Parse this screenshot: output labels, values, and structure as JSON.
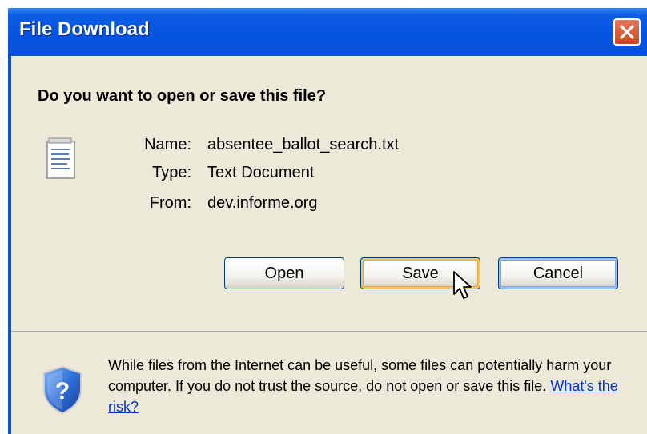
{
  "window": {
    "title": "File Download",
    "close_icon": "close-icon",
    "titlebar_color": "#0554e0",
    "body_color": "#ece9d8"
  },
  "dialog": {
    "question": "Do you want to open or save this file?",
    "file_icon": "text-document-icon",
    "fields": [
      {
        "label": "Name:",
        "value": "absentee_ballot_search.txt"
      },
      {
        "label": "Type:",
        "value": "Text Document"
      },
      {
        "label": "From:",
        "value": "dev.informe.org"
      }
    ],
    "buttons": {
      "open": "Open",
      "save": "Save",
      "cancel": "Cancel"
    }
  },
  "warning": {
    "icon": "security-shield-question-icon",
    "text": "While files from the Internet can be useful, some files can potentially harm your computer. If you do not trust the source, do not open or save this file.",
    "link": "What's the risk?"
  }
}
